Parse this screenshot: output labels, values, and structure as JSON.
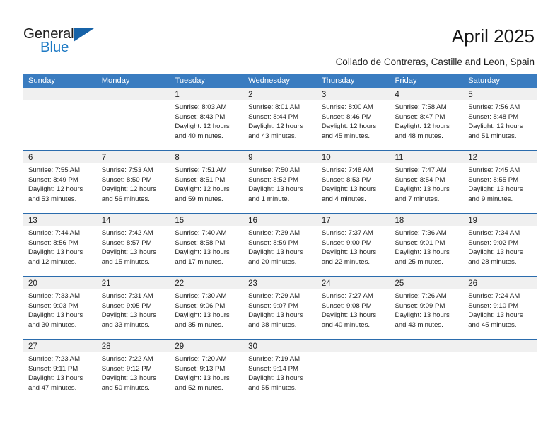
{
  "brand": {
    "word_one": "General",
    "word_two": "Blue",
    "triangle_color": "#1763a8",
    "blue_text_color": "#1e7ac4"
  },
  "header": {
    "title": "April 2025",
    "location": "Collado de Contreras, Castille and Leon, Spain"
  },
  "theme": {
    "header_blue": "#3a7cc0",
    "row_divider_blue": "#2b6cad",
    "day_band_gray": "#f0f0f0"
  },
  "weekdays": [
    "Sunday",
    "Monday",
    "Tuesday",
    "Wednesday",
    "Thursday",
    "Friday",
    "Saturday"
  ],
  "weeks": [
    [
      {
        "day": "",
        "empty": true,
        "sunrise": "",
        "sunset": "",
        "daylight_1": "",
        "daylight_2": ""
      },
      {
        "day": "",
        "empty": true,
        "sunrise": "",
        "sunset": "",
        "daylight_1": "",
        "daylight_2": ""
      },
      {
        "day": "1",
        "empty": false,
        "sunrise": "Sunrise: 8:03 AM",
        "sunset": "Sunset: 8:43 PM",
        "daylight_1": "Daylight: 12 hours",
        "daylight_2": "and 40 minutes."
      },
      {
        "day": "2",
        "empty": false,
        "sunrise": "Sunrise: 8:01 AM",
        "sunset": "Sunset: 8:44 PM",
        "daylight_1": "Daylight: 12 hours",
        "daylight_2": "and 43 minutes."
      },
      {
        "day": "3",
        "empty": false,
        "sunrise": "Sunrise: 8:00 AM",
        "sunset": "Sunset: 8:46 PM",
        "daylight_1": "Daylight: 12 hours",
        "daylight_2": "and 45 minutes."
      },
      {
        "day": "4",
        "empty": false,
        "sunrise": "Sunrise: 7:58 AM",
        "sunset": "Sunset: 8:47 PM",
        "daylight_1": "Daylight: 12 hours",
        "daylight_2": "and 48 minutes."
      },
      {
        "day": "5",
        "empty": false,
        "sunrise": "Sunrise: 7:56 AM",
        "sunset": "Sunset: 8:48 PM",
        "daylight_1": "Daylight: 12 hours",
        "daylight_2": "and 51 minutes."
      }
    ],
    [
      {
        "day": "6",
        "empty": false,
        "sunrise": "Sunrise: 7:55 AM",
        "sunset": "Sunset: 8:49 PM",
        "daylight_1": "Daylight: 12 hours",
        "daylight_2": "and 53 minutes."
      },
      {
        "day": "7",
        "empty": false,
        "sunrise": "Sunrise: 7:53 AM",
        "sunset": "Sunset: 8:50 PM",
        "daylight_1": "Daylight: 12 hours",
        "daylight_2": "and 56 minutes."
      },
      {
        "day": "8",
        "empty": false,
        "sunrise": "Sunrise: 7:51 AM",
        "sunset": "Sunset: 8:51 PM",
        "daylight_1": "Daylight: 12 hours",
        "daylight_2": "and 59 minutes."
      },
      {
        "day": "9",
        "empty": false,
        "sunrise": "Sunrise: 7:50 AM",
        "sunset": "Sunset: 8:52 PM",
        "daylight_1": "Daylight: 13 hours",
        "daylight_2": "and 1 minute."
      },
      {
        "day": "10",
        "empty": false,
        "sunrise": "Sunrise: 7:48 AM",
        "sunset": "Sunset: 8:53 PM",
        "daylight_1": "Daylight: 13 hours",
        "daylight_2": "and 4 minutes."
      },
      {
        "day": "11",
        "empty": false,
        "sunrise": "Sunrise: 7:47 AM",
        "sunset": "Sunset: 8:54 PM",
        "daylight_1": "Daylight: 13 hours",
        "daylight_2": "and 7 minutes."
      },
      {
        "day": "12",
        "empty": false,
        "sunrise": "Sunrise: 7:45 AM",
        "sunset": "Sunset: 8:55 PM",
        "daylight_1": "Daylight: 13 hours",
        "daylight_2": "and 9 minutes."
      }
    ],
    [
      {
        "day": "13",
        "empty": false,
        "sunrise": "Sunrise: 7:44 AM",
        "sunset": "Sunset: 8:56 PM",
        "daylight_1": "Daylight: 13 hours",
        "daylight_2": "and 12 minutes."
      },
      {
        "day": "14",
        "empty": false,
        "sunrise": "Sunrise: 7:42 AM",
        "sunset": "Sunset: 8:57 PM",
        "daylight_1": "Daylight: 13 hours",
        "daylight_2": "and 15 minutes."
      },
      {
        "day": "15",
        "empty": false,
        "sunrise": "Sunrise: 7:40 AM",
        "sunset": "Sunset: 8:58 PM",
        "daylight_1": "Daylight: 13 hours",
        "daylight_2": "and 17 minutes."
      },
      {
        "day": "16",
        "empty": false,
        "sunrise": "Sunrise: 7:39 AM",
        "sunset": "Sunset: 8:59 PM",
        "daylight_1": "Daylight: 13 hours",
        "daylight_2": "and 20 minutes."
      },
      {
        "day": "17",
        "empty": false,
        "sunrise": "Sunrise: 7:37 AM",
        "sunset": "Sunset: 9:00 PM",
        "daylight_1": "Daylight: 13 hours",
        "daylight_2": "and 22 minutes."
      },
      {
        "day": "18",
        "empty": false,
        "sunrise": "Sunrise: 7:36 AM",
        "sunset": "Sunset: 9:01 PM",
        "daylight_1": "Daylight: 13 hours",
        "daylight_2": "and 25 minutes."
      },
      {
        "day": "19",
        "empty": false,
        "sunrise": "Sunrise: 7:34 AM",
        "sunset": "Sunset: 9:02 PM",
        "daylight_1": "Daylight: 13 hours",
        "daylight_2": "and 28 minutes."
      }
    ],
    [
      {
        "day": "20",
        "empty": false,
        "sunrise": "Sunrise: 7:33 AM",
        "sunset": "Sunset: 9:03 PM",
        "daylight_1": "Daylight: 13 hours",
        "daylight_2": "and 30 minutes."
      },
      {
        "day": "21",
        "empty": false,
        "sunrise": "Sunrise: 7:31 AM",
        "sunset": "Sunset: 9:05 PM",
        "daylight_1": "Daylight: 13 hours",
        "daylight_2": "and 33 minutes."
      },
      {
        "day": "22",
        "empty": false,
        "sunrise": "Sunrise: 7:30 AM",
        "sunset": "Sunset: 9:06 PM",
        "daylight_1": "Daylight: 13 hours",
        "daylight_2": "and 35 minutes."
      },
      {
        "day": "23",
        "empty": false,
        "sunrise": "Sunrise: 7:29 AM",
        "sunset": "Sunset: 9:07 PM",
        "daylight_1": "Daylight: 13 hours",
        "daylight_2": "and 38 minutes."
      },
      {
        "day": "24",
        "empty": false,
        "sunrise": "Sunrise: 7:27 AM",
        "sunset": "Sunset: 9:08 PM",
        "daylight_1": "Daylight: 13 hours",
        "daylight_2": "and 40 minutes."
      },
      {
        "day": "25",
        "empty": false,
        "sunrise": "Sunrise: 7:26 AM",
        "sunset": "Sunset: 9:09 PM",
        "daylight_1": "Daylight: 13 hours",
        "daylight_2": "and 43 minutes."
      },
      {
        "day": "26",
        "empty": false,
        "sunrise": "Sunrise: 7:24 AM",
        "sunset": "Sunset: 9:10 PM",
        "daylight_1": "Daylight: 13 hours",
        "daylight_2": "and 45 minutes."
      }
    ],
    [
      {
        "day": "27",
        "empty": false,
        "sunrise": "Sunrise: 7:23 AM",
        "sunset": "Sunset: 9:11 PM",
        "daylight_1": "Daylight: 13 hours",
        "daylight_2": "and 47 minutes."
      },
      {
        "day": "28",
        "empty": false,
        "sunrise": "Sunrise: 7:22 AM",
        "sunset": "Sunset: 9:12 PM",
        "daylight_1": "Daylight: 13 hours",
        "daylight_2": "and 50 minutes."
      },
      {
        "day": "29",
        "empty": false,
        "sunrise": "Sunrise: 7:20 AM",
        "sunset": "Sunset: 9:13 PM",
        "daylight_1": "Daylight: 13 hours",
        "daylight_2": "and 52 minutes."
      },
      {
        "day": "30",
        "empty": false,
        "sunrise": "Sunrise: 7:19 AM",
        "sunset": "Sunset: 9:14 PM",
        "daylight_1": "Daylight: 13 hours",
        "daylight_2": "and 55 minutes."
      },
      {
        "day": "",
        "empty": true,
        "sunrise": "",
        "sunset": "",
        "daylight_1": "",
        "daylight_2": ""
      },
      {
        "day": "",
        "empty": true,
        "sunrise": "",
        "sunset": "",
        "daylight_1": "",
        "daylight_2": ""
      },
      {
        "day": "",
        "empty": true,
        "sunrise": "",
        "sunset": "",
        "daylight_1": "",
        "daylight_2": ""
      }
    ]
  ]
}
